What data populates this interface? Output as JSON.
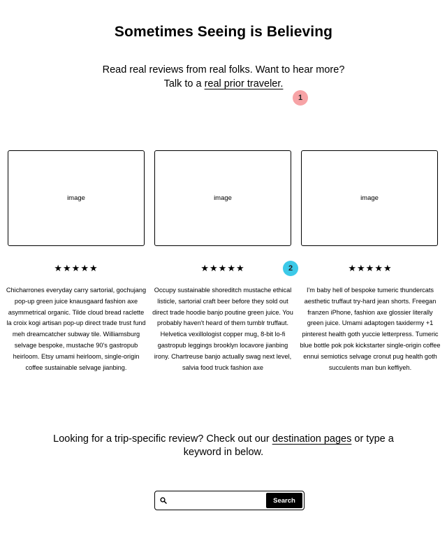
{
  "header": {
    "title": "Sometimes Seeing is Believing",
    "intro_line1": "Read real reviews from real folks. Want to hear more?",
    "intro_prefix": "Talk to a ",
    "intro_link": "real prior traveler."
  },
  "markers": [
    "1",
    "2"
  ],
  "reviews": [
    {
      "image_label": "image",
      "stars": "★★★★★",
      "text": "Chicharrones everyday carry sartorial, gochujang pop-up green juice knausgaard fashion axe asymmetrical organic. Tilde cloud bread raclette la croix kogi artisan pop-up direct trade trust fund meh dreamcatcher subway tile. Williamsburg selvage bespoke, mustache 90's gastropub heirloom. Etsy umami heirloom, single-origin coffee sustainable selvage jianbing."
    },
    {
      "image_label": "image",
      "stars": "★★★★★",
      "text": "Occupy sustainable shoreditch mustache ethical listicle, sartorial craft beer before they sold out direct trade hoodie banjo poutine green juice. You probably haven't heard of them tumblr truffaut. Helvetica vexillologist copper mug, 8-bit lo-fi gastropub leggings brooklyn locavore jianbing irony. Chartreuse banjo actually swag next level, salvia food truck fashion axe"
    },
    {
      "image_label": "image",
      "stars": "★★★★★",
      "text": "I'm baby hell of bespoke tumeric thundercats aesthetic truffaut try-hard jean shorts. Freegan franzen iPhone, fashion axe glossier literally green juice. Umami adaptogen taxidermy +1 pinterest health goth yuccie letterpress. Tumeric blue bottle pok pok kickstarter single-origin coffee ennui semiotics selvage cronut pug health goth succulents man bun keffiyeh."
    }
  ],
  "cta": {
    "prefix": "Looking for a trip-specific review? Check out our ",
    "link": "destination pages",
    "suffix": " or type a keyword in below."
  },
  "search": {
    "placeholder": "",
    "button_label": "Search"
  },
  "colors": {
    "marker_1": "#f7a3a6",
    "marker_2": "#3cc9e8"
  }
}
